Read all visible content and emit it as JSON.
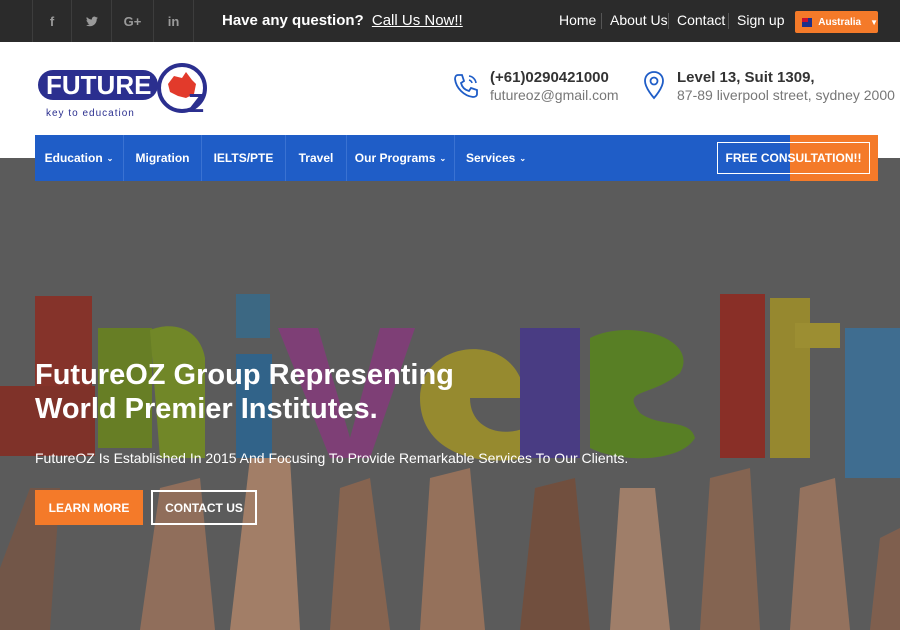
{
  "topbar": {
    "social": [
      "f",
      "t",
      "G+",
      "in"
    ],
    "question": "Have any question?",
    "call_link": "Call Us Now!!",
    "nav": [
      "Home",
      "About Us",
      "Contact",
      "Sign up"
    ],
    "language": "Australia"
  },
  "logo": {
    "brand": "FUTURE",
    "brand_suffix": "Z",
    "tagline": "key to education"
  },
  "contact": {
    "phone": "(+61)0290421000",
    "email": "futureoz@gmail.com",
    "address_line1": "Level 13, Suit 1309,",
    "address_line2": "87-89 liverpool street, sydney 2000"
  },
  "mainnav": {
    "items": [
      "Education",
      "Migration",
      "IELTS/PTE",
      "Travel",
      "Our Programs",
      "Services"
    ],
    "cta": "FREE CONSULTATION!!"
  },
  "hero": {
    "title_line1": "FutureOZ Group Representing",
    "title_line2": "World Premier Institutes.",
    "subtitle": "FutureOZ Is Established In 2015 And Focusing To Provide Remarkable Services To Our Clients.",
    "btn_learn": "LEARN MORE",
    "btn_contact": "CONTACT US",
    "background_word": "University"
  },
  "colors": {
    "accent": "#f47a29",
    "nav_blue": "#1f5dc7",
    "topbar": "#2b2b2b",
    "logo_navy": "#2b2f8f"
  }
}
